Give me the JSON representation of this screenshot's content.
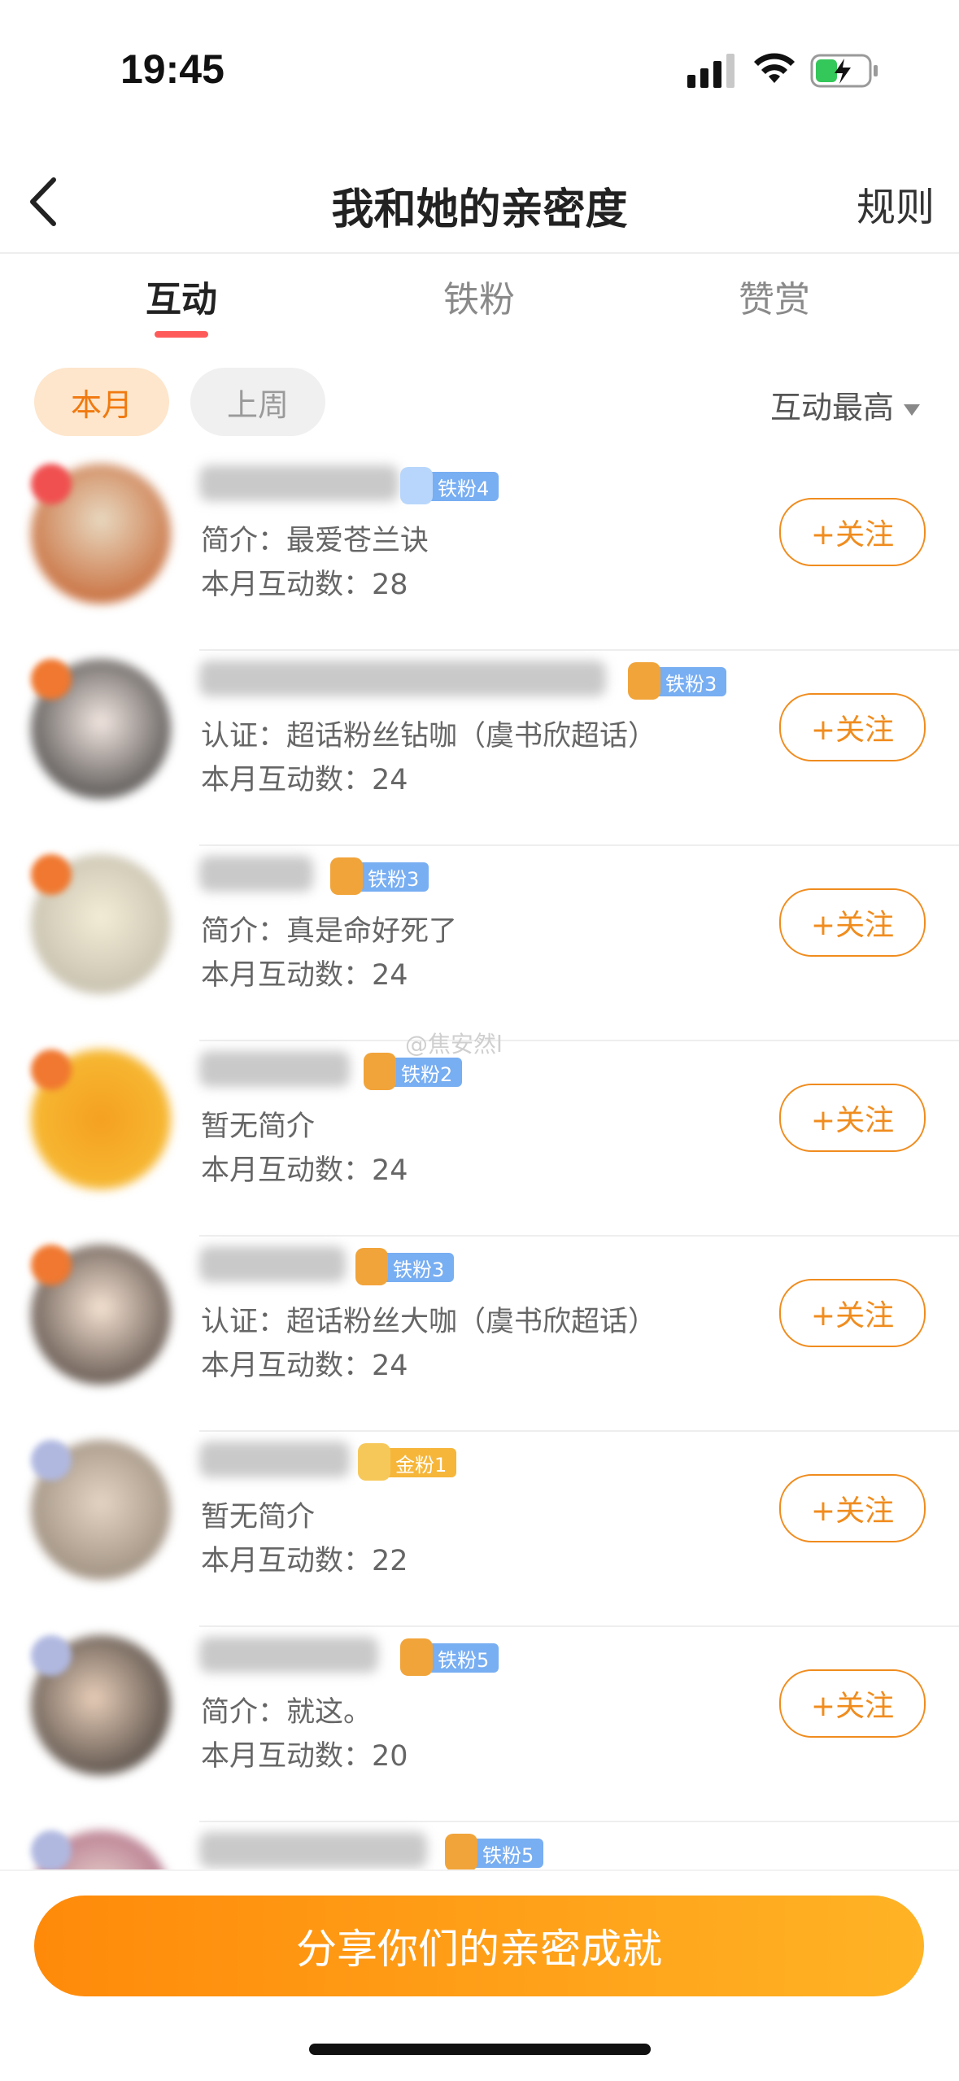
{
  "status_bar": {
    "time": "19:45"
  },
  "nav": {
    "title": "我和她的亲密度",
    "rules": "规则"
  },
  "tabs": [
    {
      "label": "互动"
    },
    {
      "label": "铁粉"
    },
    {
      "label": "赞赏"
    }
  ],
  "filters": {
    "chips": [
      {
        "label": "本月"
      },
      {
        "label": "上周"
      }
    ],
    "sort": "互动最高"
  },
  "watermark": "@焦安然l",
  "rows": [
    {
      "badge": "铁粉4",
      "intro": "简介：最爱苍兰诀",
      "count": "本月互动数：28",
      "follow": "+关注"
    },
    {
      "badge": "铁粉3",
      "intro": "认证：超话粉丝钻咖（虞书欣超话）",
      "count": "本月互动数：24",
      "follow": "+关注"
    },
    {
      "badge": "铁粉3",
      "intro": "简介：真是命好死了",
      "count": "本月互动数：24",
      "follow": "+关注"
    },
    {
      "badge": "铁粉2",
      "intro": "暂无简介",
      "count": "本月互动数：24",
      "follow": "+关注"
    },
    {
      "badge": "铁粉3",
      "intro": "认证：超话粉丝大咖（虞书欣超话）",
      "count": "本月互动数：24",
      "follow": "+关注"
    },
    {
      "badge": "金粉1",
      "intro": "暂无简介",
      "count": "本月互动数：22",
      "follow": "+关注"
    },
    {
      "badge": "铁粉5",
      "intro": "简介：就这。",
      "count": "本月互动数：20",
      "follow": "+关注"
    },
    {
      "badge": "铁粉5"
    }
  ],
  "footer": {
    "share": "分享你们的亲密成就"
  },
  "colors": {
    "accent": "#f08c1e",
    "tab_indicator": "#ff5a5a",
    "iron_badge": "#78aef2",
    "gold_badge": "#f6b63a"
  },
  "icons": [
    "back-arrow-icon",
    "signal-icon",
    "wifi-icon",
    "battery-charging-icon",
    "sort-dropdown-icon"
  ]
}
